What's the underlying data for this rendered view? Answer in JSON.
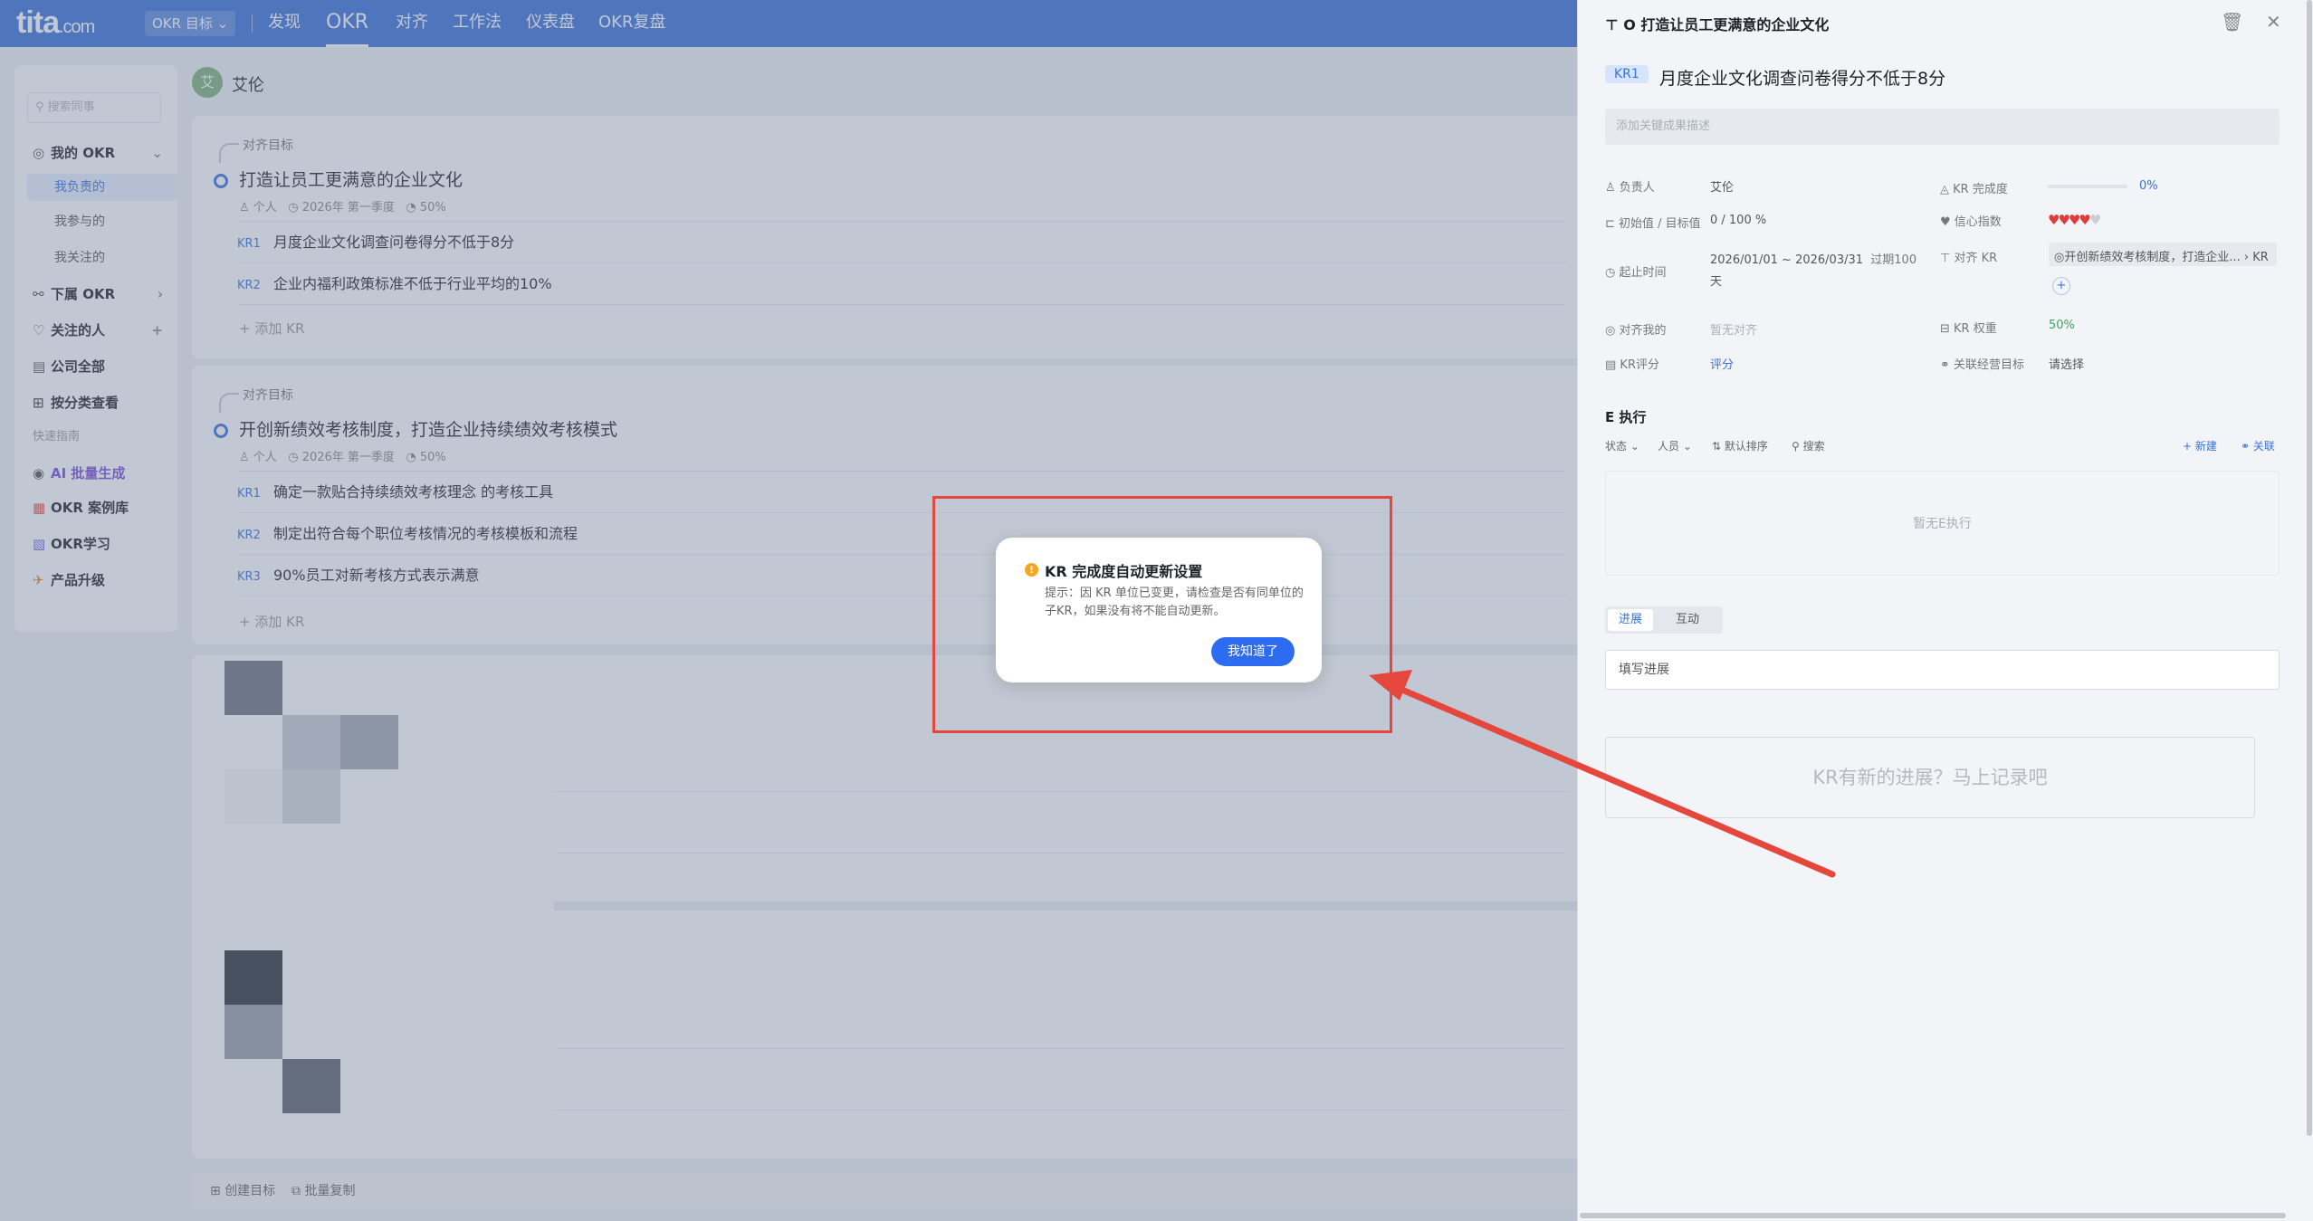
{
  "topbar": {
    "logo": "tita",
    "logo_suffix": ".com",
    "okr_select": "OKR 目标",
    "nav": [
      "发现",
      "OKR",
      "对齐",
      "工作法",
      "仪表盘",
      "OKR复盘"
    ]
  },
  "sidebar": {
    "search_placeholder": "搜索同事",
    "items": [
      {
        "label": "我的 OKR"
      },
      {
        "label": "我负责的"
      },
      {
        "label": "我参与的"
      },
      {
        "label": "我关注的"
      },
      {
        "label": "下属 OKR"
      },
      {
        "label": "关注的人"
      },
      {
        "label": "公司全部"
      },
      {
        "label": "按分类查看"
      },
      {
        "label": "快速指南"
      },
      {
        "label": "AI 批量生成"
      },
      {
        "label": "OKR 案例库"
      },
      {
        "label": "OKR学习"
      },
      {
        "label": "产品升级"
      }
    ]
  },
  "user": {
    "avatar_char": "艾",
    "name": "艾伦"
  },
  "objectives": [
    {
      "align_label": "对齐目标",
      "title": "打造让员工更满意的企业文化",
      "owner": "个人",
      "period": "2026年 第一季度",
      "progress": "50%",
      "krs": [
        {
          "tag": "KR1",
          "text": "月度企业文化调查问卷得分不低于8分"
        },
        {
          "tag": "KR2",
          "text": "企业内福利政策标准不低于行业平均的10%"
        }
      ],
      "add_kr": "+ 添加 KR"
    },
    {
      "align_label": "对齐目标",
      "title": "开创新绩效考核制度，打造企业持续绩效考核模式",
      "owner": "个人",
      "period": "2026年 第一季度",
      "progress": "50%",
      "krs": [
        {
          "tag": "KR1",
          "text": "确定一款贴合持续绩效考核理念 的考核工具"
        },
        {
          "tag": "KR2",
          "text": "制定出符合每个职位考核情况的考核模板和流程"
        },
        {
          "tag": "KR3",
          "text": "90%员工对新考核方式表示满意"
        }
      ],
      "add_kr": "+ 添加 KR"
    }
  ],
  "footer": {
    "create": "创建目标",
    "batch_copy": "批量复制"
  },
  "panel": {
    "title": "O 打造让员工更满意的企业文化",
    "kr_badge": "KR1",
    "kr_title": "月度企业文化调查问卷得分不低于8分",
    "desc_placeholder": "添加关键成果描述",
    "fields": {
      "owner_label": "负责人",
      "owner_value": "艾伦",
      "init_label": "初始值 / 目标值",
      "init_value": "0 / 100 %",
      "time_label": "起止时间",
      "time_value": "2026/01/01 ~ 2026/03/31",
      "time_extra": "过期100",
      "time_unit": "天",
      "align_me_label": "对齐我的",
      "align_me_value": "暂无对齐",
      "score_label": "KR评分",
      "score_value": "评分",
      "completion_label": "KR 完成度",
      "completion_value": "0%",
      "confidence_label": "信心指数",
      "confidence_level": 4,
      "confidence_max": 5,
      "align_kr_label": "对齐 KR",
      "align_kr_value": "◎开创新绩效考核制度，打造企业...",
      "align_kr_tag": "KR",
      "weight_label": "KR 权重",
      "weight_value": "50%",
      "link_label": "关联经营目标",
      "link_value": "请选择"
    },
    "exec_title": "E 执行",
    "toolbar": {
      "status": "状态",
      "people": "人员",
      "sort": "默认排序",
      "search": "搜索",
      "new": "+ 新建",
      "link": "关联"
    },
    "empty_exec": "暂无E执行",
    "tabs": [
      "进展",
      "互动"
    ],
    "progress_placeholder": "填写进展",
    "prompt": "KR有新的进展？马上记录吧"
  },
  "modal": {
    "title": "KR 完成度自动更新设置",
    "text": "提示：因 KR 单位已变更，请检查是否有同单位的子KR，如果没有将不能自动更新。",
    "button": "我知道了"
  },
  "colors": {
    "primary": "#3a72d8",
    "button": "#2d6cf0",
    "highlight_box": "#e5473c",
    "arrow": "#e5473c"
  }
}
